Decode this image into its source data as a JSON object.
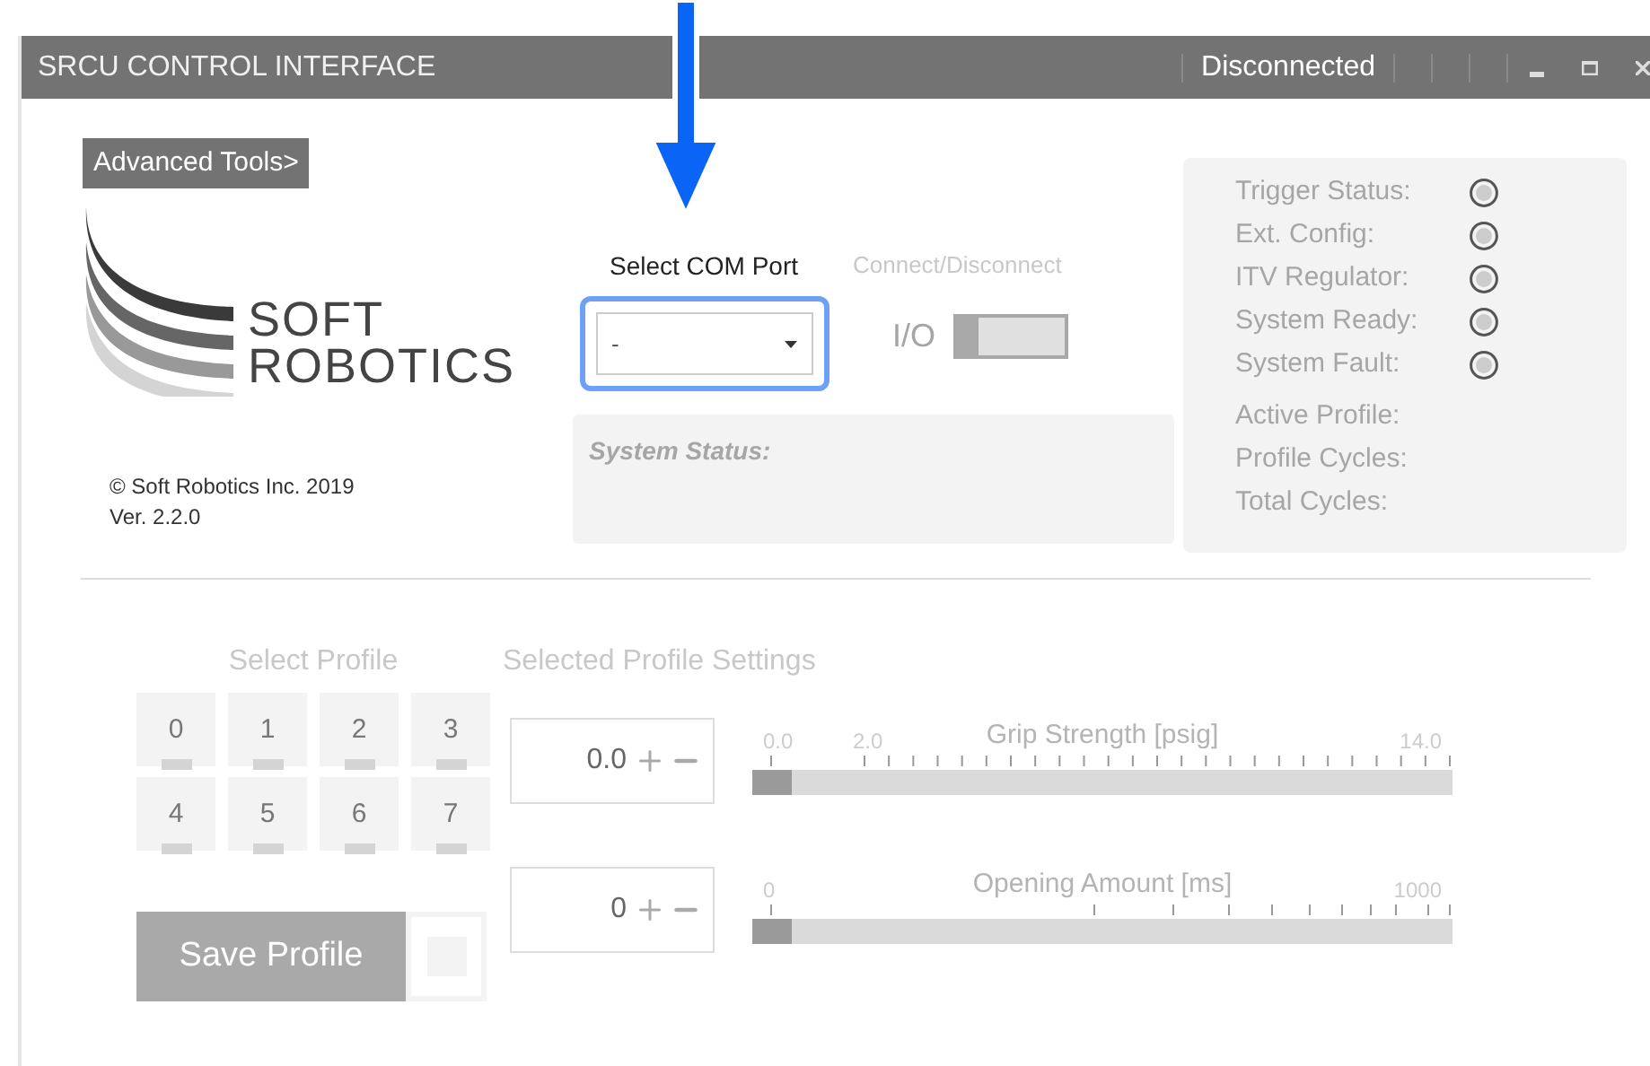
{
  "window": {
    "title": "SRCU CONTROL INTERFACE",
    "connection_status": "Disconnected"
  },
  "advanced_tools_button": "Advanced Tools>",
  "logo": {
    "line1": "SOFT",
    "line2": "ROBOTICS"
  },
  "copyright": "© Soft Robotics Inc. 2019",
  "version": "Ver. 2.2.0",
  "com_port": {
    "label": "Select COM Port",
    "value": "-"
  },
  "connection": {
    "label": "Connect/Disconnect",
    "switch_label": "I/O",
    "on": false
  },
  "system_status": {
    "label": "System Status:"
  },
  "indicators": [
    {
      "label": "Trigger Status:"
    },
    {
      "label": "Ext. Config:"
    },
    {
      "label": "ITV Regulator:"
    },
    {
      "label": "System Ready:"
    },
    {
      "label": "System Fault:"
    }
  ],
  "info": [
    "Active Profile:",
    "Profile Cycles:",
    "Total Cycles:"
  ],
  "select_profile": {
    "title": "Select Profile",
    "profiles": [
      "0",
      "1",
      "2",
      "3",
      "4",
      "5",
      "6",
      "7"
    ]
  },
  "save_button": "Save Profile",
  "settings": {
    "title": "Selected Profile Settings",
    "params": [
      {
        "name": "Grip Strength [psig]",
        "value": "0.0",
        "kind": "linear",
        "scale_labels": [
          "0.0",
          "2.0",
          "14.0"
        ],
        "level": 0
      },
      {
        "name": "Opening Amount [ms]",
        "value": "0",
        "kind": "log",
        "scale_labels": [
          "0",
          "1000"
        ],
        "level": 0
      }
    ]
  }
}
